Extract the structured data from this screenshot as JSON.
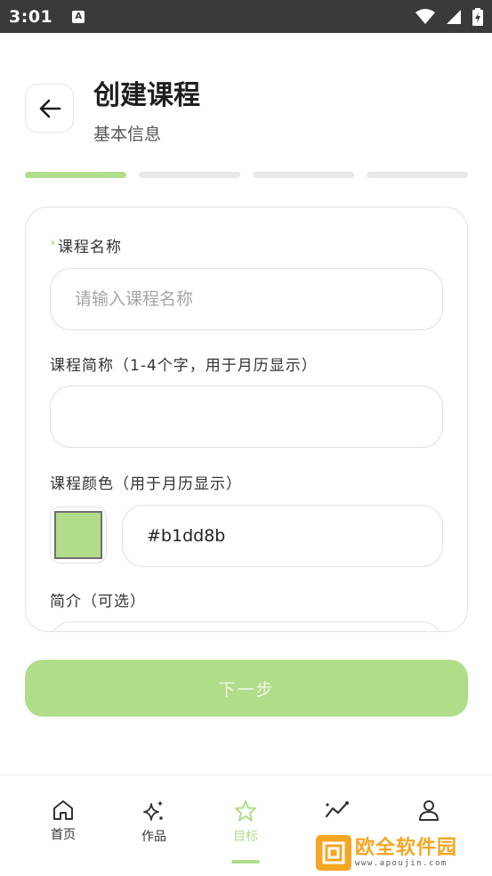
{
  "status_bar": {
    "time": "3:01",
    "app_icon_letter": "A"
  },
  "header": {
    "title": "创建课程",
    "subtitle": "基本信息"
  },
  "steps": {
    "total": 4,
    "current": 1
  },
  "form": {
    "name_label_star": "*",
    "name_label": "课程名称",
    "name_placeholder": "请输入课程名称",
    "name_value": "",
    "short_label": "课程简称（1-4个字，用于月历显示）",
    "short_value": "",
    "color_label": "课程颜色（用于月历显示）",
    "color_value": "#b1dd8b",
    "intro_label": "简介（可选）"
  },
  "next_button": "下一步",
  "bottom_nav": {
    "items": [
      {
        "label": "首页",
        "icon": "home-icon"
      },
      {
        "label": "作品",
        "icon": "sparkle-icon"
      },
      {
        "label": "目标",
        "icon": "star-icon",
        "active": true
      },
      {
        "label": "",
        "icon": "trend-icon"
      },
      {
        "label": "",
        "icon": "person-icon"
      }
    ]
  },
  "watermark": {
    "title": "欧全软件园",
    "url": "www.apoujin.com"
  },
  "colors": {
    "accent": "#b1dd8b",
    "status_bar": "#3a3a3a",
    "watermark": "#f5a623"
  }
}
